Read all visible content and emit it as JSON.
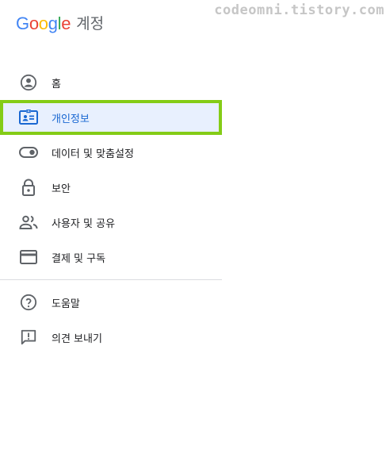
{
  "header": {
    "logo_letters": [
      "G",
      "o",
      "o",
      "g",
      "l",
      "e"
    ],
    "logo_colors": [
      "#4285F4",
      "#EA4335",
      "#FBBC05",
      "#4285F4",
      "#34A853",
      "#EA4335"
    ],
    "title": "계정"
  },
  "watermark": "codeomni.tistory.com",
  "nav": {
    "items": [
      {
        "label": "홈",
        "icon": "account-circle-icon"
      },
      {
        "label": "개인정보",
        "icon": "id-card-icon",
        "active": true
      },
      {
        "label": "데이터 및 맞춤설정",
        "icon": "toggle-icon"
      },
      {
        "label": "보안",
        "icon": "lock-icon"
      },
      {
        "label": "사용자 및 공유",
        "icon": "people-icon"
      },
      {
        "label": "결제 및 구독",
        "icon": "credit-card-icon"
      }
    ],
    "secondary": [
      {
        "label": "도움말",
        "icon": "help-icon"
      },
      {
        "label": "의견 보내기",
        "icon": "feedback-icon"
      }
    ]
  },
  "colors": {
    "accent": "#1967d2",
    "active_bg": "#e8f0fe",
    "highlight_outline": "#84cc16",
    "icon": "#5f6368"
  }
}
